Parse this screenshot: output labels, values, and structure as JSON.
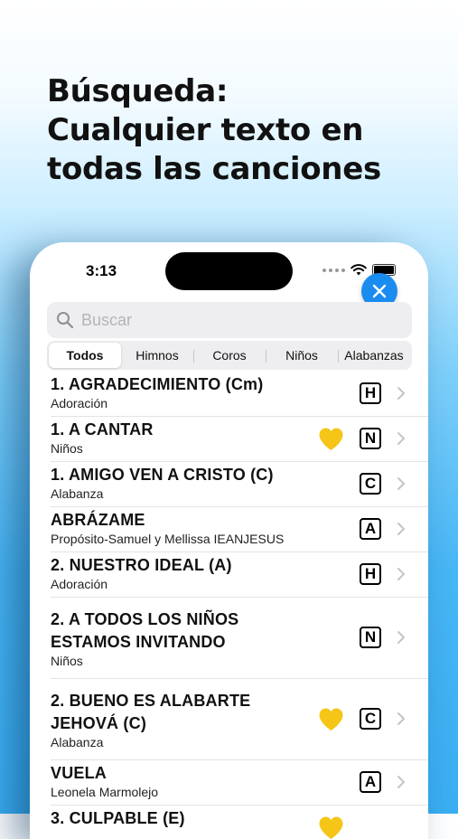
{
  "headline": [
    "Búsqueda:",
    "Cualquier texto en",
    "todas las canciones"
  ],
  "status": {
    "time": "3:13"
  },
  "search": {
    "placeholder": "Buscar"
  },
  "tabs": [
    "Todos",
    "Himnos",
    "Coros",
    "Niños",
    "Alabanzas"
  ],
  "active_tab": "Todos",
  "colors": {
    "accent": "#1a8cf0",
    "heart": "#f5c518"
  },
  "songs": [
    {
      "title_lines": [
        "1. AGRADECIMIENTO (Cm)"
      ],
      "subtitle": "Adoración",
      "type": "H",
      "favorite": false
    },
    {
      "title_lines": [
        "1. A CANTAR"
      ],
      "subtitle": "Niños",
      "type": "N",
      "favorite": true
    },
    {
      "title_lines": [
        "1. AMIGO VEN A CRISTO (C)"
      ],
      "subtitle": "Alabanza",
      "type": "C",
      "favorite": false
    },
    {
      "title_lines": [
        "ABRÁZAME"
      ],
      "subtitle": "Propósito-Samuel y Mellissa IEANJESUS",
      "type": "A",
      "favorite": false
    },
    {
      "title_lines": [
        "2. NUESTRO IDEAL (A)"
      ],
      "subtitle": "Adoración",
      "type": "H",
      "favorite": false
    },
    {
      "title_lines": [
        "2. A TODOS LOS NIÑOS",
        "ESTAMOS INVITANDO"
      ],
      "subtitle": "Niños",
      "type": "N",
      "favorite": false
    },
    {
      "title_lines": [
        "2. BUENO ES ALABARTE",
        "JEHOVÁ (C)"
      ],
      "subtitle": "Alabanza",
      "type": "C",
      "favorite": true
    },
    {
      "title_lines": [
        "VUELA"
      ],
      "subtitle": "Leonela Marmolejo",
      "type": "A",
      "favorite": false
    },
    {
      "title_lines": [
        "3. CULPABLE (E)"
      ],
      "subtitle": "",
      "type": "",
      "favorite": true
    }
  ]
}
